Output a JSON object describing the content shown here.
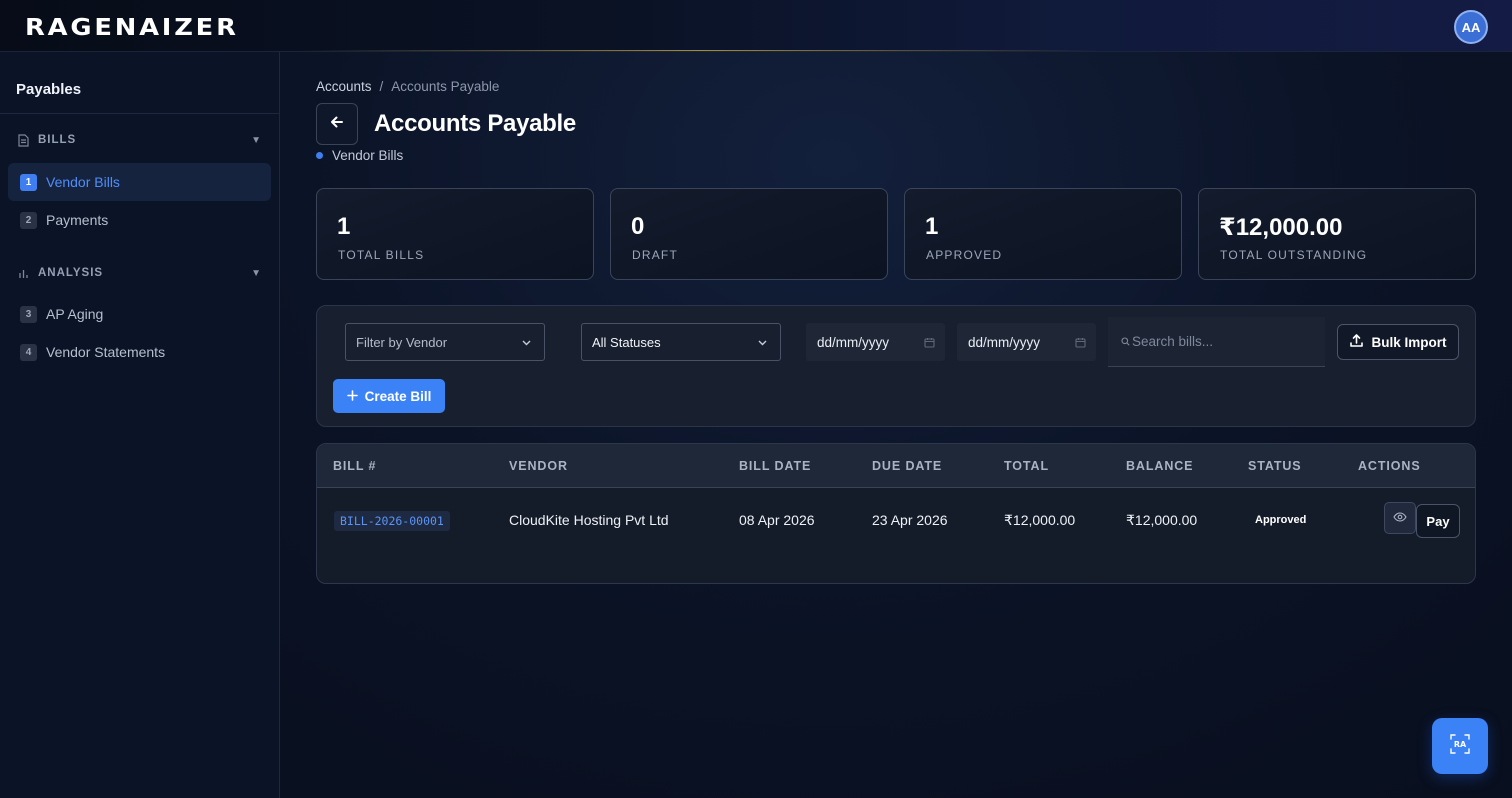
{
  "app": {
    "logo_text": "RAGENAIZER",
    "avatar_initials": "AA"
  },
  "sidebar": {
    "title": "Payables",
    "sections": [
      {
        "label": "BILLS",
        "icon": "document-icon",
        "expanded": true
      },
      {
        "label": "ANALYSIS",
        "icon": "bar-chart-icon",
        "expanded": true
      }
    ],
    "items": [
      {
        "num": "1",
        "label": "Vendor Bills",
        "active": true
      },
      {
        "num": "2",
        "label": "Payments",
        "active": false
      },
      {
        "num": "3",
        "label": "AP Aging",
        "active": false
      },
      {
        "num": "4",
        "label": "Vendor Statements",
        "active": false
      }
    ]
  },
  "breadcrumb": {
    "items": [
      "Accounts",
      "Accounts Payable"
    ],
    "separator": "/"
  },
  "page": {
    "title": "Accounts Payable",
    "subtitle": "Vendor Bills"
  },
  "stats": [
    {
      "value": "1",
      "label": "TOTAL BILLS"
    },
    {
      "value": "0",
      "label": "DRAFT"
    },
    {
      "value": "1",
      "label": "APPROVED"
    },
    {
      "value": "₹12,000.00",
      "label": "TOTAL OUTSTANDING"
    }
  ],
  "filters": {
    "vendor_placeholder": "Filter by Vendor",
    "status_value": "All Statuses",
    "date_from_placeholder": "dd/mm/yyyy",
    "date_to_placeholder": "dd/mm/yyyy",
    "search_placeholder": "Search bills...",
    "bulk_import_label": "Bulk Import",
    "create_bill_label": "Create Bill"
  },
  "table": {
    "columns": [
      "BILL #",
      "VENDOR",
      "BILL DATE",
      "DUE DATE",
      "TOTAL",
      "BALANCE",
      "STATUS",
      "ACTIONS"
    ],
    "rows": [
      {
        "bill_no": "BILL-2026-00001",
        "vendor": "CloudKite Hosting Pvt Ltd",
        "bill_date": "08 Apr 2026",
        "due_date": "23 Apr 2026",
        "total": "₹12,000.00",
        "balance": "₹12,000.00",
        "status": "Approved",
        "pay_label": "Pay"
      }
    ]
  },
  "colors": {
    "accent": "#3b82f6",
    "background": "#0b1326",
    "sidebar_bg": "#0b1426"
  }
}
